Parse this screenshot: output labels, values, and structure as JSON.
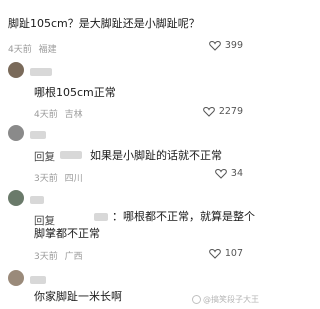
{
  "comments": [
    {
      "text": "脚趾105cm？是大脚趾还是小脚趾呢？",
      "time": "4天前",
      "location": "福建",
      "likes": "399"
    },
    {
      "text": "哪根105cm正常",
      "time": "4天前",
      "location": "吉林",
      "likes": "2279"
    },
    {
      "reply_label": "回复",
      "text": "如果是小脚趾的话就不正常",
      "time": "3天前",
      "location": "四川",
      "likes": "34"
    },
    {
      "text_line1": "：哪根都不正常，就算是整个",
      "text_line2": "脚掌都不正常",
      "time": "3天前",
      "location": "广西",
      "likes": "107"
    },
    {
      "text": "你家脚趾一米长啊"
    }
  ],
  "ui": {
    "reply": "回复",
    "watermark": "@搞笑段子大王"
  }
}
